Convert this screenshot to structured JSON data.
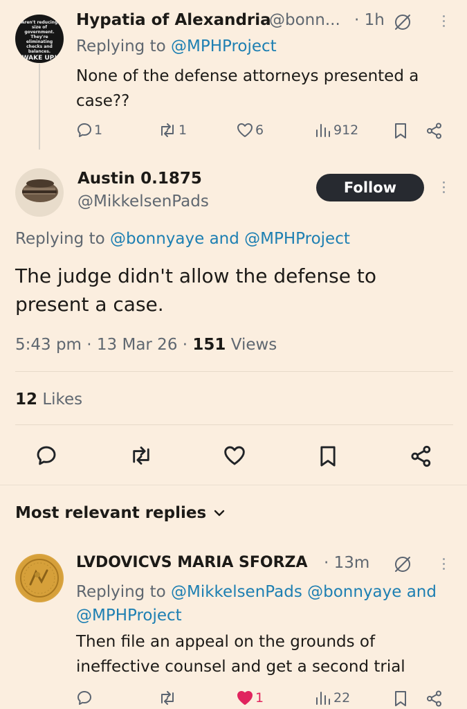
{
  "tweet1": {
    "avatar_text": [
      "Aren't reducing",
      "size of government.",
      "They're eliminating",
      "checks and balances.",
      "WAKE UP!"
    ],
    "name": "Hypatia of Alexandria",
    "handle": "@bonn...",
    "time": "· 1h",
    "replying_prefix": "Replying to",
    "replying_to": "@MPHProject",
    "text_line1": "None of the defense attorneys presented a",
    "text_line2": "case??",
    "counts": {
      "replies": "1",
      "reposts": "1",
      "likes": "6",
      "views": "912"
    }
  },
  "main": {
    "name": "Austin 0.1875",
    "handle": "@MikkelsenPads",
    "follow_label": "Follow",
    "replying_prefix": "Replying to",
    "replying_to": "@bonnyaye and @MPHProject",
    "text_line1": "The judge didn't allow the defense to",
    "text_line2": "present a case.",
    "meta_time": "5:43 pm · 13 Mar 26 ·",
    "views_count": "151",
    "views_label": "Views",
    "likes_count": "12",
    "likes_label": "Likes"
  },
  "replies_header": {
    "label": "Most relevant replies"
  },
  "tweet2": {
    "name": "LVDOVICVS MARIA SFORZA",
    "time": "· 13m",
    "replying_prefix": "Replying to",
    "replying_line1": "@MikkelsenPads @bonnyaye and",
    "replying_line2": "@MPHProject",
    "text_line1": "Then file an appeal on the grounds of",
    "text_line2": "ineffective counsel and get a second trial",
    "counts": {
      "likes": "1",
      "views": "22"
    }
  },
  "colors": {
    "accent": "#1d7fb2",
    "like_active": "#e0245e",
    "follow_bg": "#272a30"
  }
}
